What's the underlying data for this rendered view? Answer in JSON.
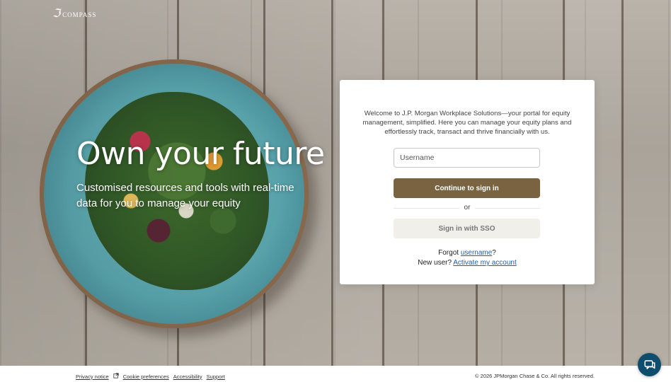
{
  "brand": {
    "logo_text": "COMPASS"
  },
  "hero": {
    "headline": "Own your future",
    "subtext": "Customised resources and tools with real-time data for you to manage your equity"
  },
  "login": {
    "intro": "Welcome to J.P. Morgan Workplace Solutions—your portal for equity management, simplified. Here you can manage your equity plans and effortlessly track, transact and thrive financially with us.",
    "username_placeholder": "Username",
    "continue_label": "Continue to sign in",
    "or_label": "or",
    "sso_label": "Sign in with SSO",
    "forgot_prefix": "Forgot ",
    "forgot_link": "username",
    "forgot_suffix": "?",
    "new_user_prefix": "New user? ",
    "activate_link": "Activate my account"
  },
  "footer": {
    "links": [
      "Privacy notice",
      "Cookie preferences",
      "Accessibility",
      "Support"
    ],
    "copyright": "© 2026 JPMorgan Chase & Co. All rights reserved."
  },
  "colors": {
    "primary_button": "#7a6340",
    "link": "#1f5fa8",
    "chat_button": "#0f4d6e"
  },
  "icons": {
    "logo": "compass-logo-icon",
    "external": "external-link-icon",
    "chat": "chat-icon"
  }
}
